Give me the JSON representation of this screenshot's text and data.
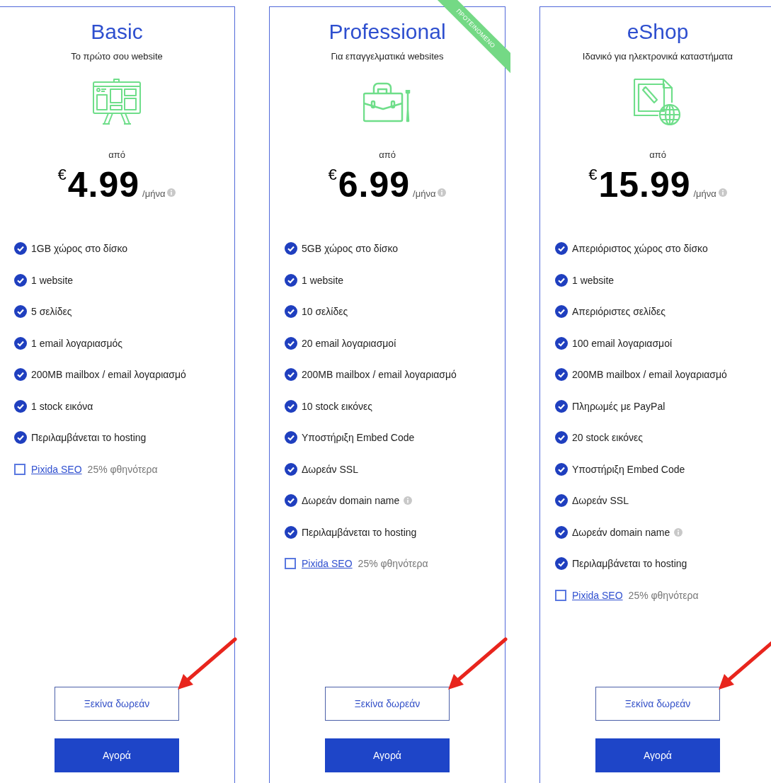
{
  "plans": [
    {
      "name": "Basic",
      "tagline": "Το πρώτο σου website",
      "kind": "easel",
      "recommended": false,
      "from": "από",
      "currency": "€",
      "price": "4.99",
      "period": "/μήνα",
      "features": [
        {
          "kind": "check",
          "text": "1GB χώρος στο δίσκο",
          "info": false
        },
        {
          "kind": "check",
          "text": "1 website",
          "info": false
        },
        {
          "kind": "check",
          "text": "5 σελίδες",
          "info": false
        },
        {
          "kind": "check",
          "text": "1 email λογαριασμός",
          "info": false
        },
        {
          "kind": "check",
          "text": "200MB mailbox / email λογαριασμό",
          "info": false
        },
        {
          "kind": "check",
          "text": "1 stock εικόνα",
          "info": false
        },
        {
          "kind": "check",
          "text": "Περιλαμβάνεται το hosting",
          "info": false
        },
        {
          "kind": "addon",
          "link": "Pixida SEO",
          "text": "25% φθηνότερα",
          "checked": false
        }
      ],
      "trial_button": "Ξεκίνα δωρεάν",
      "buy_button": "Αγορά"
    },
    {
      "name": "Professional",
      "tagline": "Για επαγγελματικά websites",
      "kind": "briefcase",
      "recommended": true,
      "ribbon": "ΠΡΟΤΕΙΝΟΜΕΝΟ",
      "from": "από",
      "currency": "€",
      "price": "6.99",
      "period": "/μήνα",
      "features": [
        {
          "kind": "check",
          "text": "5GB χώρος στο δίσκο",
          "info": false
        },
        {
          "kind": "check",
          "text": "1 website",
          "info": false
        },
        {
          "kind": "check",
          "text": "10 σελίδες",
          "info": false
        },
        {
          "kind": "check",
          "text": "20 email λογαριασμοί",
          "info": false
        },
        {
          "kind": "check",
          "text": "200MB mailbox / email λογαριασμό",
          "info": false
        },
        {
          "kind": "check",
          "text": "10 stock εικόνες",
          "info": false
        },
        {
          "kind": "check",
          "text": "Υποστήριξη Embed Code",
          "info": false
        },
        {
          "kind": "check",
          "text": "Δωρεάν SSL",
          "info": false
        },
        {
          "kind": "check",
          "text": "Δωρεάν domain name",
          "info": true
        },
        {
          "kind": "check",
          "text": "Περιλαμβάνεται το hosting",
          "info": false
        },
        {
          "kind": "addon",
          "link": "Pixida SEO",
          "text": "25% φθηνότερα",
          "checked": false
        }
      ],
      "trial_button": "Ξεκίνα δωρεάν",
      "buy_button": "Αγορά"
    },
    {
      "name": "eShop",
      "tagline": "Ιδανικό για ηλεκτρονικά καταστήματα",
      "kind": "document-globe",
      "recommended": false,
      "from": "από",
      "currency": "€",
      "price": "15.99",
      "period": "/μήνα",
      "features": [
        {
          "kind": "check",
          "text": "Απεριόριστος χώρος στο δίσκο",
          "info": false
        },
        {
          "kind": "check",
          "text": "1 website",
          "info": false
        },
        {
          "kind": "check",
          "text": "Απεριόριστες σελίδες",
          "info": false
        },
        {
          "kind": "check",
          "text": "100 email λογαριασμοί",
          "info": false
        },
        {
          "kind": "check",
          "text": "200MB mailbox / email λογαριασμό",
          "info": false
        },
        {
          "kind": "check",
          "text": "Πληρωμές με PayPal",
          "info": false
        },
        {
          "kind": "check",
          "text": "20 stock εικόνες",
          "info": false
        },
        {
          "kind": "check",
          "text": "Υποστήριξη Embed Code",
          "info": false
        },
        {
          "kind": "check",
          "text": "Δωρεάν SSL",
          "info": false
        },
        {
          "kind": "check",
          "text": "Δωρεάν domain name",
          "info": true
        },
        {
          "kind": "check",
          "text": "Περιλαμβάνεται το hosting",
          "info": false
        },
        {
          "kind": "addon",
          "link": "Pixida SEO",
          "text": "25% φθηνότερα",
          "checked": false
        }
      ],
      "trial_button": "Ξεκίνα δωρεάν",
      "buy_button": "Αγορά"
    }
  ]
}
